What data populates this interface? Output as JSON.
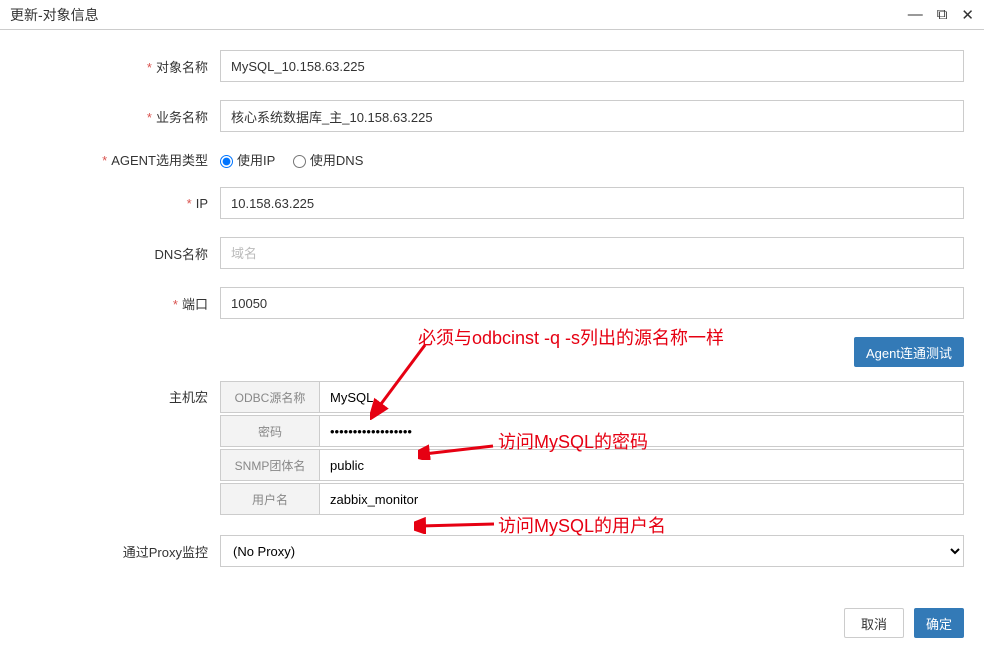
{
  "window": {
    "title": "更新-对象信息"
  },
  "form": {
    "object_name": {
      "label": "对象名称",
      "value": "MySQL_10.158.63.225"
    },
    "business_name": {
      "label": "业务名称",
      "value": "核心系统数据库_主_10.158.63.225"
    },
    "agent_type": {
      "label": "AGENT选用类型",
      "opt_ip": "使用IP",
      "opt_dns": "使用DNS"
    },
    "ip": {
      "label": "IP",
      "value": "10.158.63.225"
    },
    "dns": {
      "label": "DNS名称",
      "placeholder": "域名"
    },
    "port": {
      "label": "端口",
      "value": "10050"
    },
    "agent_test_btn": "Agent连通测试",
    "host_macro": {
      "label": "主机宏",
      "odbc": {
        "label": "ODBC源名称",
        "value": "MySQL"
      },
      "password": {
        "label": "密码",
        "value": "••••••••••••••••••"
      },
      "snmp": {
        "label": "SNMP团体名",
        "value": "public"
      },
      "username": {
        "label": "用户名",
        "value": "zabbix_monitor"
      }
    },
    "proxy": {
      "label": "通过Proxy监控",
      "value": "(No Proxy)"
    }
  },
  "buttons": {
    "cancel": "取消",
    "confirm": "确定"
  },
  "annotations": {
    "odbc_note": "必须与odbcinst -q -s列出的源名称一样",
    "password_note": "访问MySQL的密码",
    "username_note": "访问MySQL的用户名"
  }
}
